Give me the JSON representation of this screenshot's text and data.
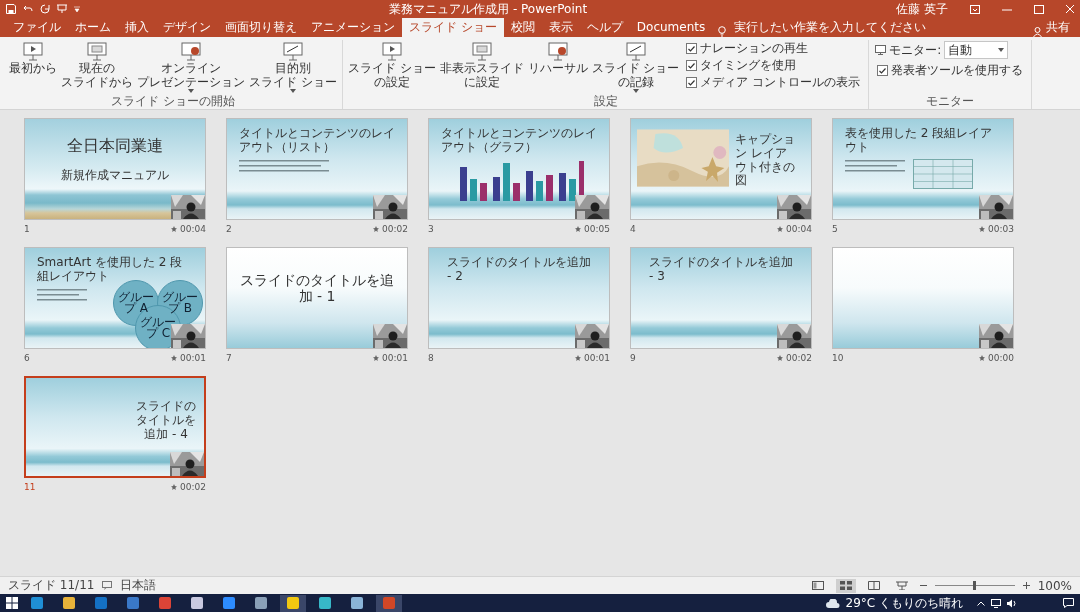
{
  "window": {
    "title": "業務マニュアル作成用 - PowerPoint",
    "user": "佐藤 英子"
  },
  "tabs": [
    {
      "label": "ファイル",
      "selected": false
    },
    {
      "label": "ホーム",
      "selected": false
    },
    {
      "label": "挿入",
      "selected": false
    },
    {
      "label": "デザイン",
      "selected": false
    },
    {
      "label": "画面切り替え",
      "selected": false
    },
    {
      "label": "アニメーション",
      "selected": false
    },
    {
      "label": "スライド ショー",
      "selected": true
    },
    {
      "label": "校閲",
      "selected": false
    },
    {
      "label": "表示",
      "selected": false
    },
    {
      "label": "ヘルプ",
      "selected": false
    },
    {
      "label": "Documents",
      "selected": false
    }
  ],
  "tell_me": {
    "placeholder": "実行したい作業を入力してください"
  },
  "share": "共有",
  "ribbon": {
    "groups": [
      {
        "label": "スライド ショーの開始",
        "items": [
          {
            "kind": "button",
            "lines": [
              "最初から"
            ],
            "dropdown": false
          },
          {
            "kind": "button",
            "lines": [
              "現在の",
              "スライドから"
            ],
            "dropdown": false
          },
          {
            "kind": "button",
            "lines": [
              "オンライン",
              "プレゼンテーション"
            ],
            "dropdown": true
          },
          {
            "kind": "button",
            "lines": [
              "目的別",
              "スライド ショー"
            ],
            "dropdown": true
          }
        ]
      },
      {
        "label": "設定",
        "items": [
          {
            "kind": "button",
            "lines": [
              "スライド ショー",
              "の設定"
            ],
            "dropdown": false
          },
          {
            "kind": "button",
            "lines": [
              "非表示スライド",
              "に設定"
            ],
            "dropdown": false
          },
          {
            "kind": "button",
            "lines": [
              "リハーサル"
            ],
            "dropdown": false
          },
          {
            "kind": "button",
            "lines": [
              "スライド ショー",
              "の記録"
            ],
            "dropdown": true
          },
          {
            "kind": "checks",
            "options": [
              {
                "label": "ナレーションの再生",
                "checked": true
              },
              {
                "label": "タイミングを使用",
                "checked": true
              },
              {
                "label": "メディア コントロールの表示",
                "checked": true
              }
            ]
          }
        ]
      },
      {
        "label": "モニター",
        "items": [
          {
            "kind": "monitor",
            "label": "モニター:",
            "value": "自動"
          },
          {
            "kind": "checks",
            "options": [
              {
                "label": "発表者ツールを使用する",
                "checked": true
              }
            ]
          }
        ]
      }
    ]
  },
  "slides": [
    {
      "number": "1",
      "time": "00:04",
      "kind": "title",
      "title": "全日本同業連",
      "subtitle": "新規作成マニュアル",
      "selected": false
    },
    {
      "number": "2",
      "time": "00:02",
      "kind": "list",
      "title": "タイトルとコンテンツのレイアウト（リスト）",
      "selected": false
    },
    {
      "number": "3",
      "time": "00:05",
      "kind": "chart",
      "title": "タイトルとコンテンツのレイアウト（グラフ）",
      "selected": false
    },
    {
      "number": "4",
      "time": "00:04",
      "kind": "picture",
      "title": "キャプション レイアウト付きの図",
      "selected": false
    },
    {
      "number": "5",
      "time": "00:03",
      "kind": "table",
      "title": "表を使用した 2 段組レイアウト",
      "selected": false
    },
    {
      "number": "6",
      "time": "00:01",
      "kind": "smartart",
      "title": "SmartArt を使用した 2 段組レイアウト",
      "circles": [
        "グループ A",
        "グループ B",
        "グループ C"
      ],
      "selected": false
    },
    {
      "number": "7",
      "time": "00:01",
      "kind": "center",
      "title": "スライドのタイトルを追加 - 1",
      "selected": false
    },
    {
      "number": "8",
      "time": "00:01",
      "kind": "heading",
      "title": "スライドのタイトルを追加 - 2",
      "selected": false
    },
    {
      "number": "9",
      "time": "00:02",
      "kind": "heading",
      "title": "スライドのタイトルを追加 - 3",
      "selected": false
    },
    {
      "number": "10",
      "time": "00:00",
      "kind": "blank",
      "selected": false
    },
    {
      "number": "11",
      "time": "00:02",
      "kind": "right",
      "title": "スライドのタイトルを追加 - 4",
      "selected": true
    }
  ],
  "status_bar": {
    "slide": "スライド 11/11",
    "language": "日本語",
    "views": [
      {
        "kind": "normal",
        "selected": false
      },
      {
        "kind": "sorter",
        "selected": true
      },
      {
        "kind": "reading",
        "selected": false
      },
      {
        "kind": "slideshow",
        "selected": false
      }
    ],
    "zoom_slider": {
      "level": 0.5
    },
    "zoom": "100%"
  },
  "taskbar": {
    "apps": [
      {
        "color": "#1f8fd6",
        "active": false
      },
      {
        "color": "#e8b33a",
        "active": false
      },
      {
        "color": "#1470c4",
        "active": false
      },
      {
        "color": "#3a78c8",
        "active": false
      },
      {
        "color": "#db4437",
        "active": false
      },
      {
        "color": "#c9c9e0",
        "active": false
      },
      {
        "color": "#2d8cff",
        "active": false
      },
      {
        "color": "#8aa0b8",
        "active": false
      },
      {
        "color": "#f2c811",
        "active": true
      },
      {
        "color": "#37b8c8",
        "active": false
      },
      {
        "color": "#8ab4d8",
        "active": false
      },
      {
        "color": "#d24726",
        "active": true
      }
    ],
    "weather": "29°C くもりのち晴れ"
  }
}
